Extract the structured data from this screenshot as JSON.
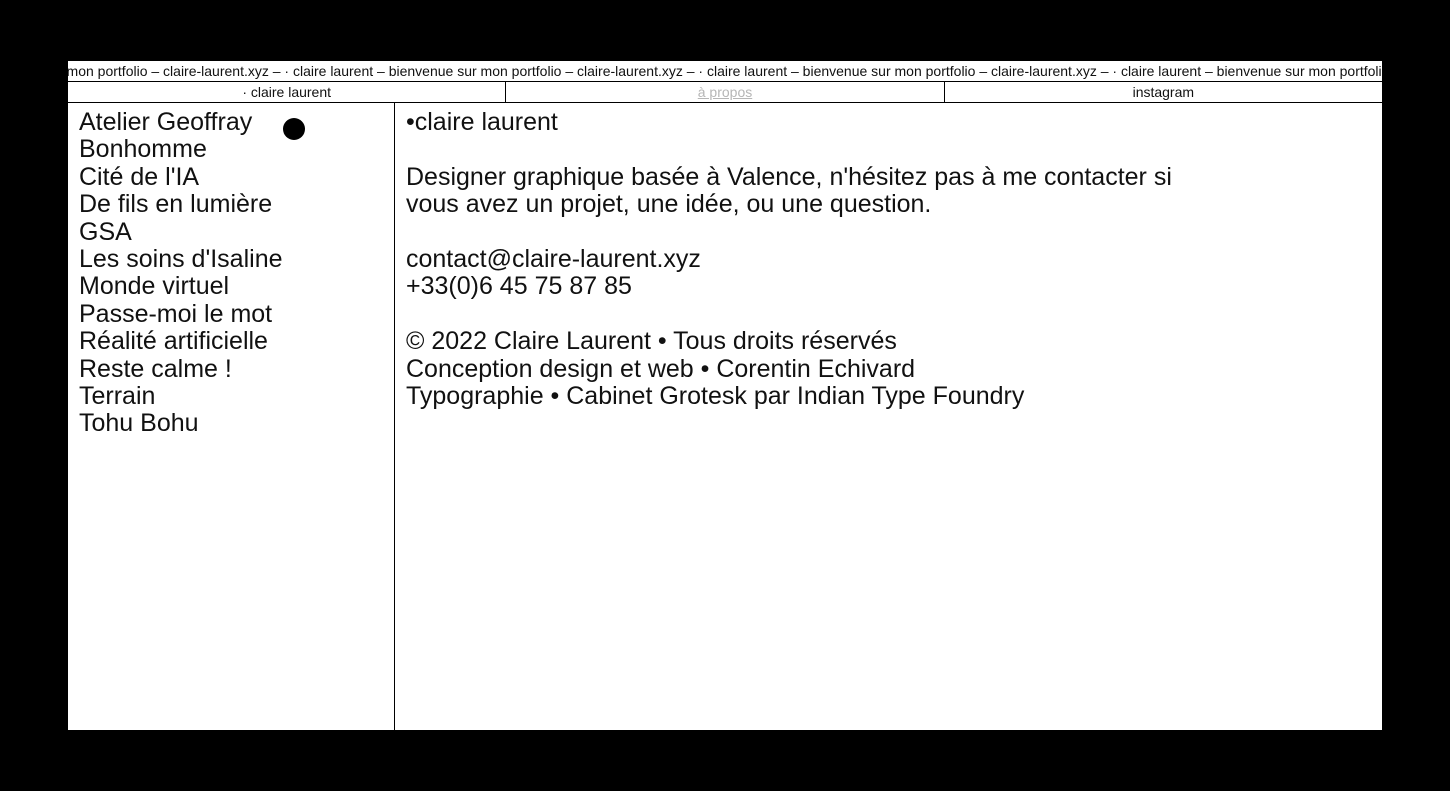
{
  "marquee": {
    "text": "· mon portfolio – claire-laurent.xyz – · claire laurent – bienvenue sur mon portfolio – claire-laurent.xyz – · claire laurent – bienvenue sur mon portfolio – claire-laurent.xyz – · claire laurent – bienvenue sur mon portfolio"
  },
  "nav": {
    "home": "· claire laurent",
    "about": "à propos",
    "instagram": "instagram"
  },
  "projects": [
    "Atelier Geoffray",
    "Bonhomme",
    "Cité de l'IA",
    "De fils en lumière",
    "GSA",
    "Les soins d'Isaline",
    "Monde virtuel",
    "Passe-moi le mot",
    "Réalité artificielle",
    "Reste calme !",
    "Terrain",
    "Tohu Bohu"
  ],
  "about": {
    "name": "•claire laurent",
    "bio_line1": "Designer graphique basée à Valence, n'hésitez pas à me contacter si",
    "bio_line2": "vous avez un projet, une idée, ou une question.",
    "email": "contact@claire-laurent.xyz",
    "phone": "+33(0)6 45 75 87 85",
    "copyright": "© 2022 Claire Laurent • Tous droits réservés",
    "credit_design": "Conception design et web • Corentin Echivard",
    "credit_type": "Typographie • Cabinet Grotesk par Indian Type Foundry"
  }
}
